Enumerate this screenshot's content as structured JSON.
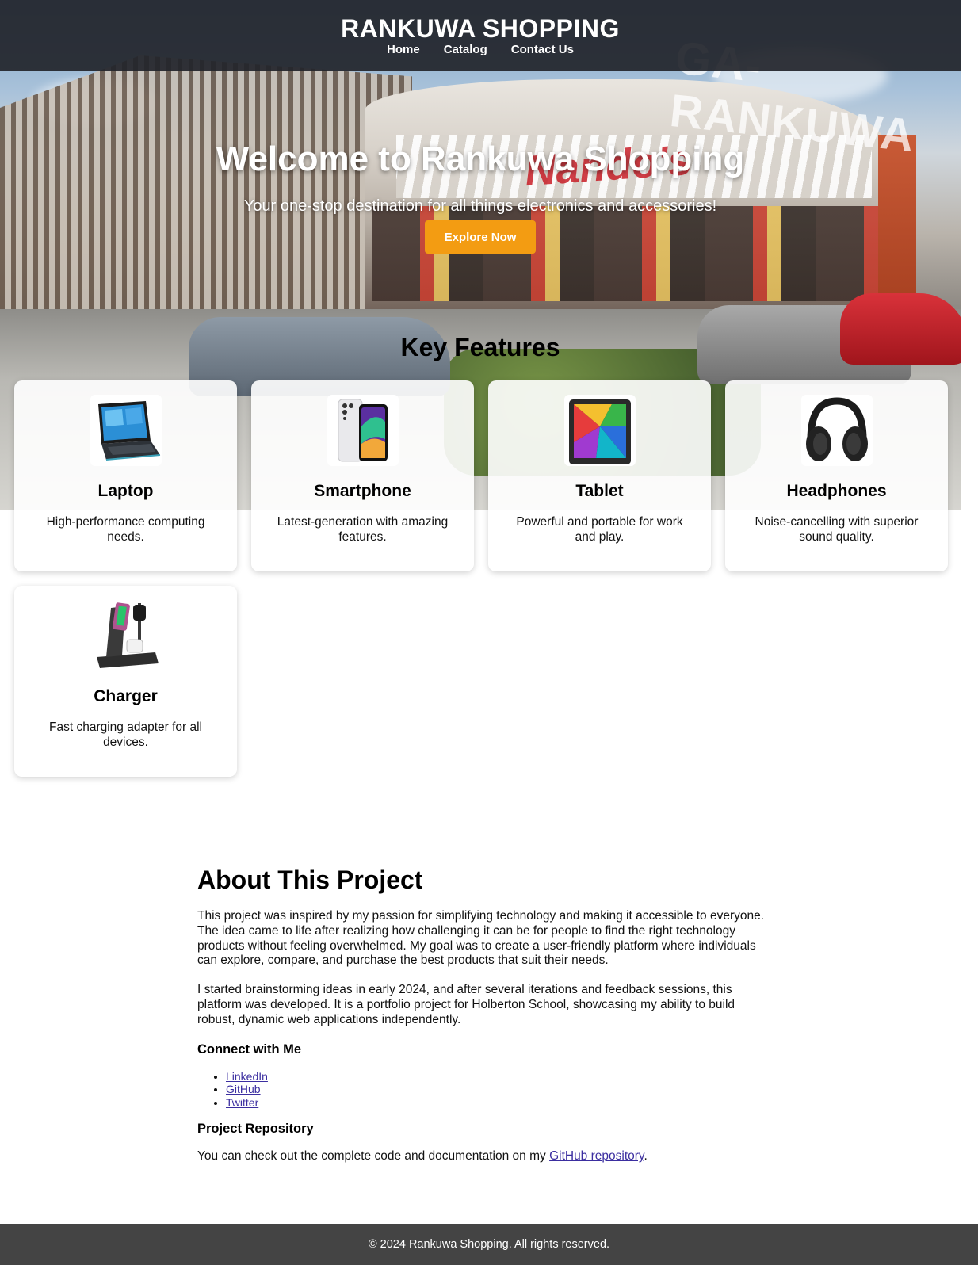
{
  "header": {
    "title": "RANKUWA SHOPPING",
    "nav": [
      "Home",
      "Catalog",
      "Contact Us"
    ]
  },
  "hero": {
    "title": "Welcome to Rankuwa Shopping",
    "subtitle": "Your one-stop destination for all things electronics and accessories!",
    "cta_label": "Explore Now",
    "background_sign": "GA-RANKUWA",
    "background_brand": "Nando's"
  },
  "features": {
    "title": "Key Features",
    "cards": [
      {
        "name": "Laptop",
        "description": "High-performance computing needs.",
        "icon": "laptop-icon"
      },
      {
        "name": "Smartphone",
        "description": "Latest-generation with amazing features.",
        "icon": "smartphone-icon"
      },
      {
        "name": "Tablet",
        "description": "Powerful and portable for work and play.",
        "icon": "tablet-icon"
      },
      {
        "name": "Headphones",
        "description": "Noise-cancelling with superior sound quality.",
        "icon": "headphones-icon"
      },
      {
        "name": "Charger",
        "description": "Fast charging adapter for all devices.",
        "icon": "charger-icon"
      }
    ]
  },
  "about": {
    "title": "About This Project",
    "paragraph1": "This project was inspired by my passion for simplifying technology and making it accessible to everyone. The idea came to life after realizing how challenging it can be for people to find the right technology products without feeling overwhelmed. My goal was to create a user-friendly platform where individuals can explore, compare, and purchase the best products that suit their needs.",
    "paragraph2": "I started brainstorming ideas in early 2024, and after several iterations and feedback sessions, this platform was developed. It is a portfolio project for Holberton School, showcasing my ability to build robust, dynamic web applications independently.",
    "connect_title": "Connect with Me",
    "links": [
      "LinkedIn",
      "GitHub",
      "Twitter"
    ],
    "repo_title": "Project Repository",
    "repo_text": "You can check out the complete code and documentation on my ",
    "repo_link": "GitHub repository",
    "repo_end": "."
  },
  "footer": {
    "text": "© 2024 Rankuwa Shopping. All rights reserved."
  },
  "colors": {
    "header_bg": "#22242a",
    "cta": "#f39c12",
    "footer_bg": "#444444",
    "link": "#3b2ea0"
  }
}
